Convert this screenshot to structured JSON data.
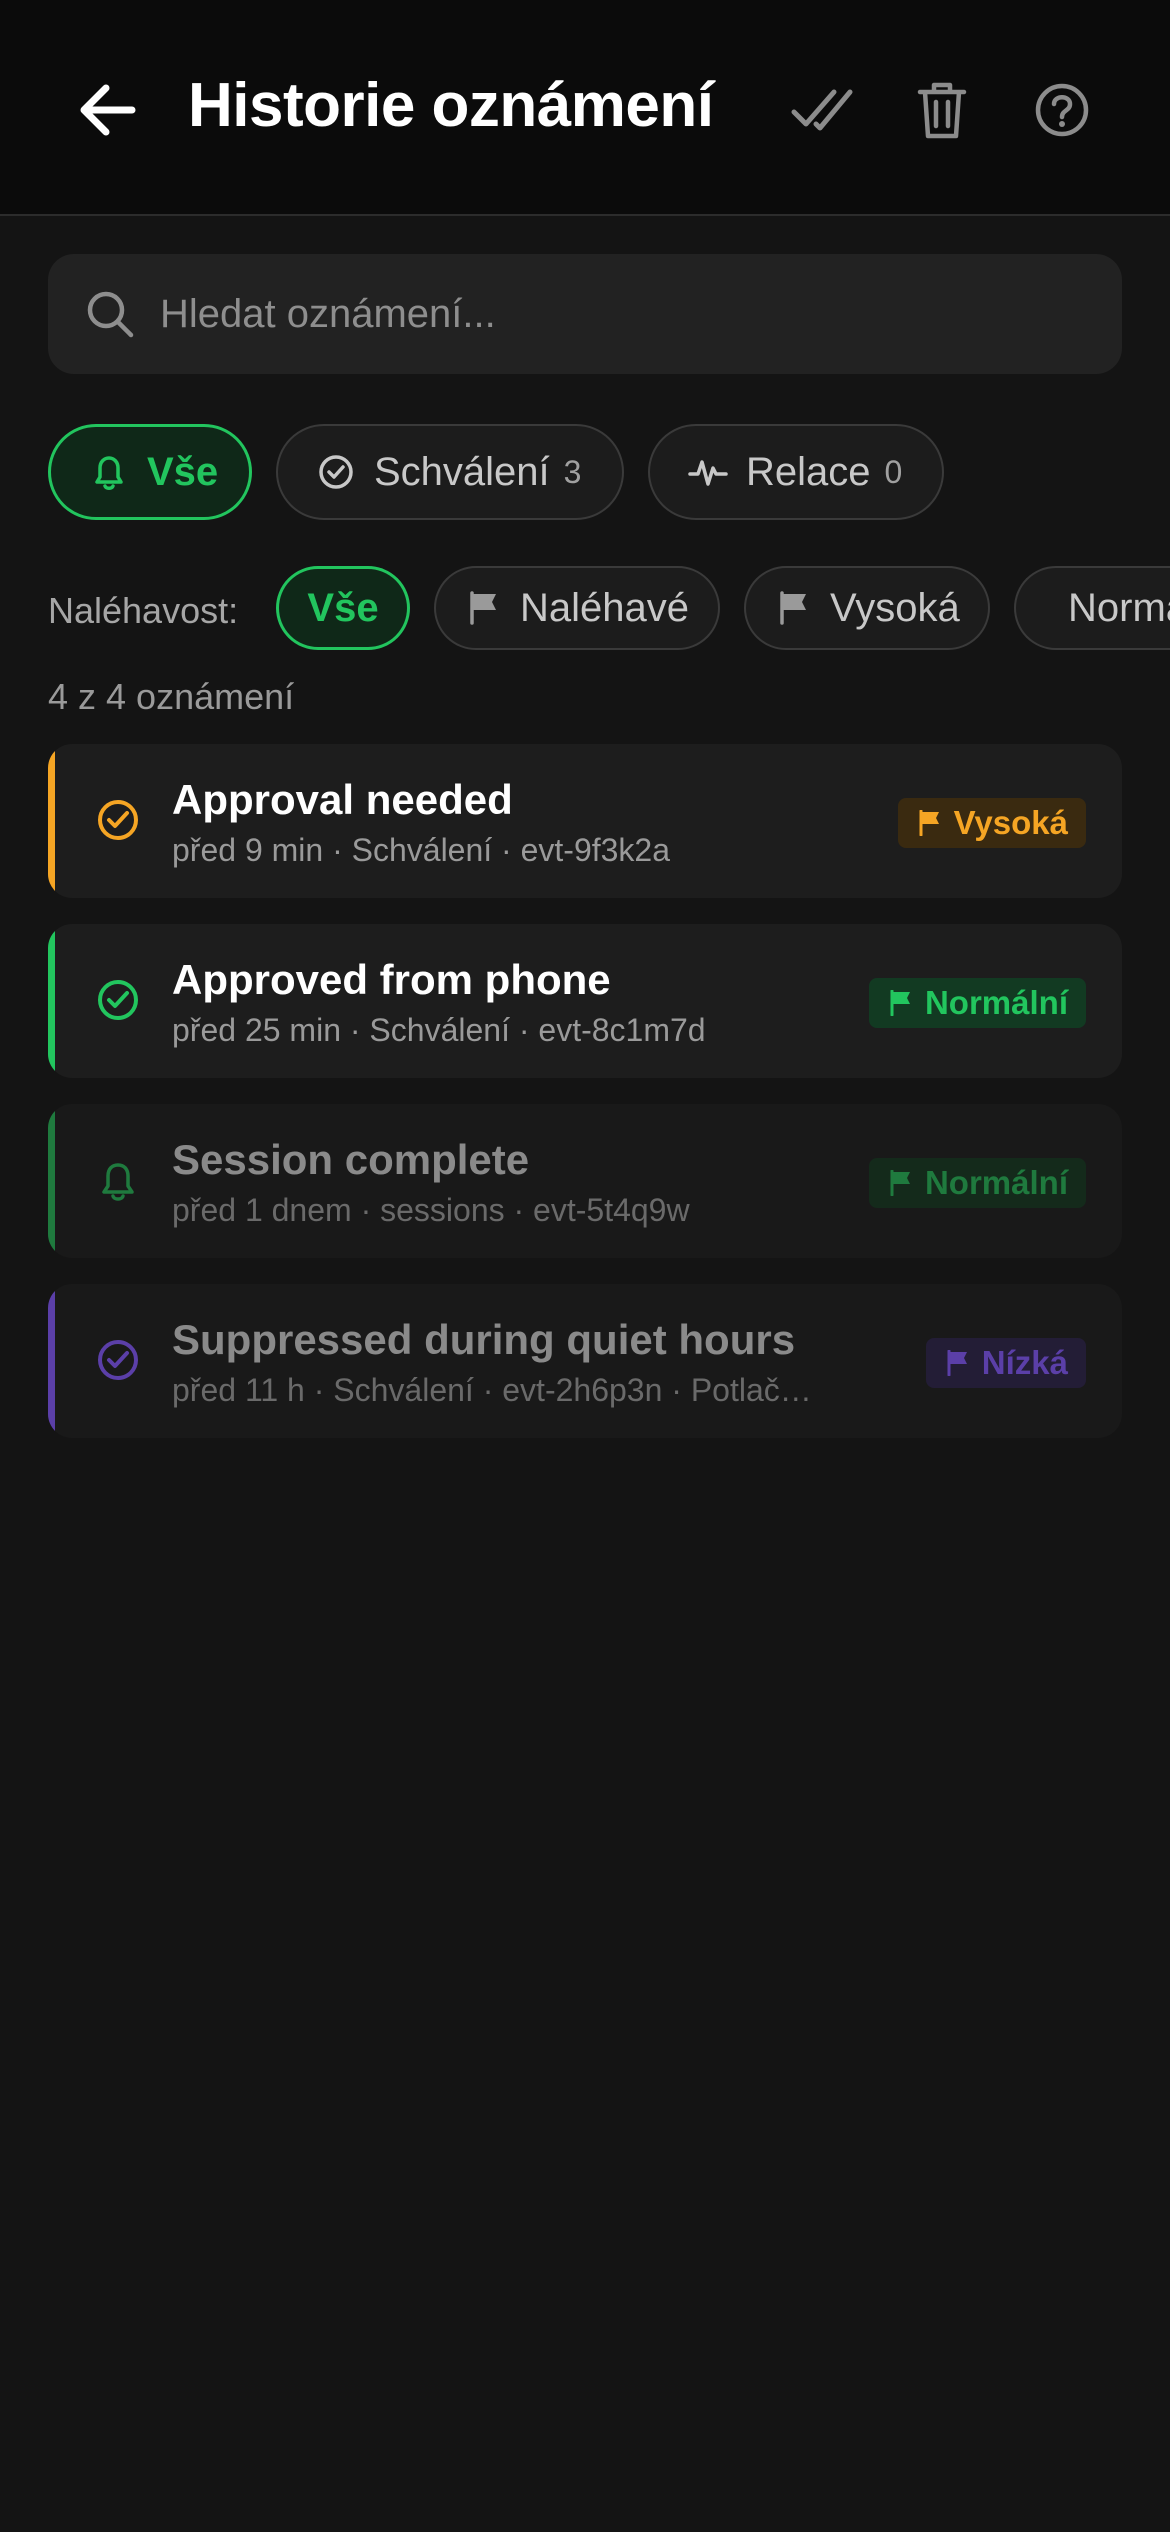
{
  "header": {
    "title": "Historie oznámení",
    "back_icon": "arrow-left-icon",
    "mark_all_read_icon": "double-check-icon",
    "delete_icon": "trash-icon",
    "help_icon": "help-circle-icon"
  },
  "search": {
    "placeholder": "Hledat oznámení...",
    "value": ""
  },
  "type_filters": [
    {
      "label": "Vše",
      "icon": "bell-icon",
      "count": "",
      "active": true
    },
    {
      "label": "Schválení",
      "icon": "check-circle-icon",
      "count": "3",
      "active": false
    },
    {
      "label": "Relace",
      "icon": "activity-icon",
      "count": "0",
      "active": false
    }
  ],
  "severity": {
    "label": "Naléhavost:",
    "options": [
      {
        "label": "Vše",
        "active": true
      },
      {
        "label": "Naléhavé",
        "active": false
      },
      {
        "label": "Vysoká",
        "active": false
      },
      {
        "label": "Normální",
        "active": false
      }
    ]
  },
  "result_count": "4 z 4 oznámení",
  "notifications": [
    {
      "title": "Approval needed",
      "meta": "před 9 min · Schválení · evt-9f3k2a",
      "icon": "check-circle-icon",
      "badge": "Vysoká",
      "accent": "#f5a524",
      "badge_bg": "#3a2a10",
      "dimmed": false
    },
    {
      "title": "Approved from phone",
      "meta": "před 25 min · Schválení · evt-8c1m7d",
      "icon": "check-circle-icon",
      "badge": "Normální",
      "accent": "#22c55e",
      "badge_bg": "#123a22",
      "dimmed": false
    },
    {
      "title": "Session complete",
      "meta": "před 1 dnem · sessions · evt-5t4q9w",
      "icon": "bell-icon",
      "badge": "Normální",
      "accent": "#1f7a3e",
      "badge_bg": "#142a1b",
      "dimmed": true
    },
    {
      "title": "Suppressed during quiet hours",
      "meta": "před 11 h · Schválení · evt-2h6p3n · Potlač…",
      "icon": "check-circle-icon",
      "badge": "Nízká",
      "accent": "#5b3fa8",
      "badge_bg": "#231d36",
      "dimmed": true
    }
  ]
}
